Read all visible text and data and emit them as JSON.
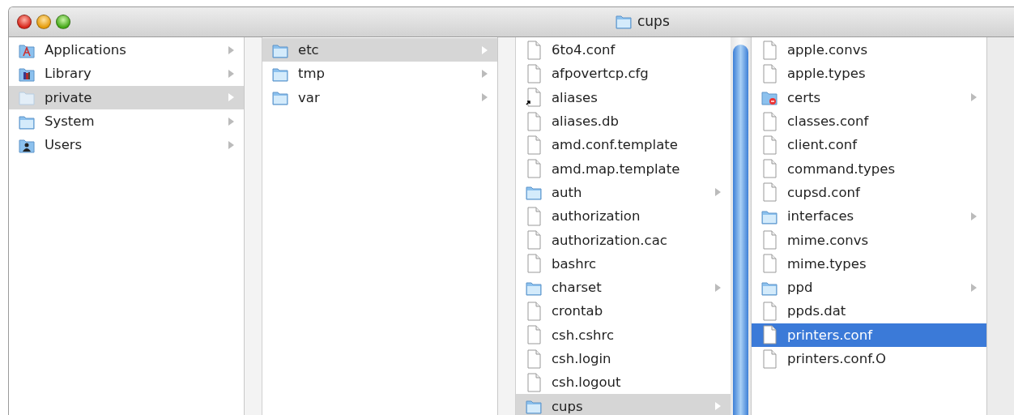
{
  "window": {
    "title": "cups"
  },
  "columns": [
    {
      "active": false,
      "items": [
        {
          "name": "Applications",
          "kind": "applications",
          "has_children": true,
          "selected": false
        },
        {
          "name": "Library",
          "kind": "library",
          "has_children": true,
          "selected": false
        },
        {
          "name": "private",
          "kind": "plain-folder",
          "has_children": true,
          "selected": true
        },
        {
          "name": "System",
          "kind": "folder",
          "has_children": true,
          "selected": false
        },
        {
          "name": "Users",
          "kind": "users",
          "has_children": true,
          "selected": false
        }
      ]
    },
    {
      "active": false,
      "items": [
        {
          "name": "etc",
          "kind": "folder",
          "has_children": true,
          "selected": true
        },
        {
          "name": "tmp",
          "kind": "folder",
          "has_children": true,
          "selected": false
        },
        {
          "name": "var",
          "kind": "folder",
          "has_children": true,
          "selected": false
        }
      ]
    },
    {
      "active": false,
      "scrollbar": true,
      "items": [
        {
          "name": "6to4.conf",
          "kind": "file",
          "has_children": false,
          "selected": false
        },
        {
          "name": "afpovertcp.cfg",
          "kind": "file",
          "has_children": false,
          "selected": false
        },
        {
          "name": "aliases",
          "kind": "alias",
          "has_children": false,
          "selected": false
        },
        {
          "name": "aliases.db",
          "kind": "file",
          "has_children": false,
          "selected": false
        },
        {
          "name": "amd.conf.template",
          "kind": "file",
          "has_children": false,
          "selected": false
        },
        {
          "name": "amd.map.template",
          "kind": "file",
          "has_children": false,
          "selected": false
        },
        {
          "name": "auth",
          "kind": "folder",
          "has_children": true,
          "selected": false
        },
        {
          "name": "authorization",
          "kind": "file",
          "has_children": false,
          "selected": false
        },
        {
          "name": "authorization.cac",
          "kind": "file",
          "has_children": false,
          "selected": false
        },
        {
          "name": "bashrc",
          "kind": "file",
          "has_children": false,
          "selected": false
        },
        {
          "name": "charset",
          "kind": "folder",
          "has_children": true,
          "selected": false
        },
        {
          "name": "crontab",
          "kind": "file",
          "has_children": false,
          "selected": false
        },
        {
          "name": "csh.cshrc",
          "kind": "file",
          "has_children": false,
          "selected": false
        },
        {
          "name": "csh.login",
          "kind": "file",
          "has_children": false,
          "selected": false
        },
        {
          "name": "csh.logout",
          "kind": "file",
          "has_children": false,
          "selected": false
        },
        {
          "name": "cups",
          "kind": "folder",
          "has_children": true,
          "selected": true
        }
      ]
    },
    {
      "active": true,
      "items": [
        {
          "name": "apple.convs",
          "kind": "file",
          "has_children": false,
          "selected": false
        },
        {
          "name": "apple.types",
          "kind": "file",
          "has_children": false,
          "selected": false
        },
        {
          "name": "certs",
          "kind": "locked-folder",
          "has_children": true,
          "selected": false
        },
        {
          "name": "classes.conf",
          "kind": "file",
          "has_children": false,
          "selected": false
        },
        {
          "name": "client.conf",
          "kind": "file",
          "has_children": false,
          "selected": false
        },
        {
          "name": "command.types",
          "kind": "file",
          "has_children": false,
          "selected": false
        },
        {
          "name": "cupsd.conf",
          "kind": "file",
          "has_children": false,
          "selected": false
        },
        {
          "name": "interfaces",
          "kind": "folder",
          "has_children": true,
          "selected": false
        },
        {
          "name": "mime.convs",
          "kind": "file",
          "has_children": false,
          "selected": false
        },
        {
          "name": "mime.types",
          "kind": "file",
          "has_children": false,
          "selected": false
        },
        {
          "name": "ppd",
          "kind": "folder",
          "has_children": true,
          "selected": false
        },
        {
          "name": "ppds.dat",
          "kind": "file",
          "has_children": false,
          "selected": false
        },
        {
          "name": "printers.conf",
          "kind": "file",
          "has_children": false,
          "selected": true
        },
        {
          "name": "printers.conf.O",
          "kind": "file",
          "has_children": false,
          "selected": false
        }
      ]
    }
  ]
}
